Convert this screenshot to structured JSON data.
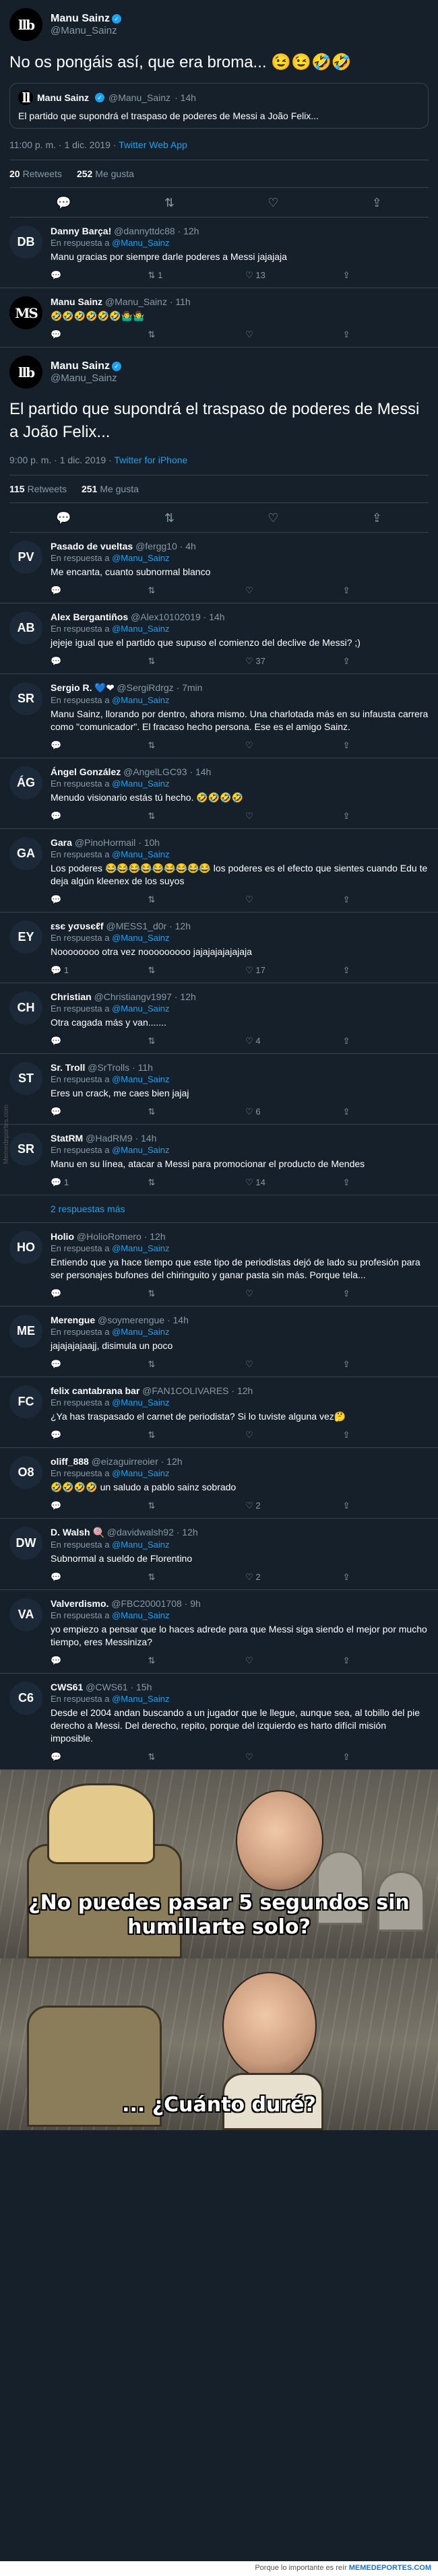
{
  "main_tweet": {
    "author": "Manu Sainz",
    "handle": "@Manu_Sainz",
    "text": "No os pongáis así, que era broma... 😉😉🤣🤣",
    "quote": {
      "author": "Manu Sainz",
      "handle": "@Manu_Sainz",
      "time": "· 14h",
      "text": "El partido que supondrá el traspaso de poderes de Messi a João Felix..."
    },
    "meta": "11:00 p. m. · 1 dic. 2019 · ",
    "source": "Twitter Web App",
    "retweets": "20",
    "retweets_label": "Retweets",
    "likes": "252",
    "likes_label": "Me gusta"
  },
  "thread_replies": [
    {
      "initials": "DB",
      "name": "Danny Barça!",
      "handle": "@dannyttdc88 · 12h",
      "reply_to_prefix": "En respuesta a ",
      "reply_to": "@Manu_Sainz",
      "text": "Manu gracias por siempre darle poderes a Messi jajajaja",
      "replies": "",
      "retweets": "1",
      "likes": "13"
    },
    {
      "initials": "MS",
      "name": "Manu Sainz",
      "handle": "@Manu_Sainz · 11h",
      "text": "🤣🤣🤣🤣🤣🤣🤷‍♂️🤷‍♂️",
      "replies": "",
      "retweets": "",
      "likes": ""
    }
  ],
  "thread_tweet": {
    "author": "Manu Sainz",
    "handle": "@Manu_Sainz",
    "text": "El partido que supondrá el traspaso de poderes de Messi a João Felix...",
    "meta": "9:00 p. m. · 1 dic. 2019 · ",
    "source": "Twitter for iPhone",
    "retweets": "115",
    "retweets_label": "Retweets",
    "likes": "251",
    "likes_label": "Me gusta"
  },
  "replies": [
    {
      "initials": "PV",
      "name": "Pasado de vueltas",
      "handle": "@fergg10 · 4h",
      "text": "Me encanta, cuanto subnormal blanco",
      "replies": "",
      "retweets": "",
      "likes": ""
    },
    {
      "initials": "AB",
      "name": "Alex Bergantiños",
      "handle": "@Alex10102019 · 14h",
      "text": "jejeje igual que el partido que supuso el comienzo del declive de Messi? ;)",
      "replies": "",
      "retweets": "",
      "likes": "37"
    },
    {
      "initials": "SR",
      "name": "Sergio R. 💙❤",
      "handle": "@SergiRdrgz · 7min",
      "text": "Manu Sainz, llorando por dentro, ahora mismo. Una charlotada más en su infausta carrera como \"comunicador\". El fracaso hecho persona. Ese es el amigo Sainz.",
      "replies": "",
      "retweets": "",
      "likes": ""
    },
    {
      "initials": "ÁG",
      "name": "Ángel González",
      "handle": "@AngelLGC93 · 14h",
      "text": "Menudo visionario estás tú hecho. 🤣🤣🤣🤣",
      "replies": "",
      "retweets": "",
      "likes": ""
    },
    {
      "initials": "GA",
      "name": "Gara",
      "handle": "@PinoHormail · 10h",
      "text": "Los poderes 😂😂😂😂😂😂😂😂😂 los poderes es el efecto que sientes cuando Edu te deja algún kleenex de los suyos",
      "replies": "",
      "retweets": "",
      "likes": ""
    },
    {
      "initials": "EY",
      "name": "εѕє уσυsєℓf",
      "handle": "@MESS1_d0r · 12h",
      "text": "Noooooooo otra vez nooooooooo jajajajajajajaja",
      "replies": "1",
      "retweets": "",
      "likes": "17"
    },
    {
      "initials": "CH",
      "name": "Christian",
      "handle": "@Christiangv1997 · 12h",
      "text": "Otra cagada más y van.......",
      "replies": "",
      "retweets": "",
      "likes": "4"
    },
    {
      "initials": "ST",
      "name": "Sr. Troll",
      "handle": "@SrTrolls · 11h",
      "text": "Eres un crack, me caes bien jajaj",
      "replies": "",
      "retweets": "",
      "likes": "6"
    },
    {
      "initials": "SR",
      "name": "StatRM",
      "handle": "@HadRM9 · 14h",
      "text": "Manu en su línea, atacar a Messi para promocionar el producto de Mendes",
      "replies": "1",
      "retweets": "",
      "likes": "14"
    }
  ],
  "more_replies": "2 respuestas más",
  "replies2": [
    {
      "initials": "HO",
      "name": "Holio",
      "handle": "@HolioRomero · 12h",
      "text": "Entiendo que ya hace tiempo que este tipo de periodistas dejó de lado su profesión para ser personajes bufones del chiringuito y ganar pasta sin más. Porque tela...",
      "replies": "",
      "retweets": "",
      "likes": ""
    },
    {
      "initials": "ME",
      "name": "Merengue",
      "handle": "@soymerengue · 14h",
      "text": "jajajajajaajj, disimula un poco",
      "replies": "",
      "retweets": "",
      "likes": ""
    },
    {
      "initials": "FC",
      "name": "felix cantabrana bar",
      "handle": "@FAN1COLIVARES · 12h",
      "text": "¿Ya has traspasado el carnet de periodista? Si lo tuviste alguna vez🤔",
      "replies": "",
      "retweets": "",
      "likes": ""
    },
    {
      "initials": "O8",
      "name": "oliff_888",
      "handle": "@eizaguirreoier · 12h",
      "text": "🤣🤣🤣🤣 un saludo a pablo sainz sobrado",
      "replies": "",
      "retweets": "",
      "likes": "2"
    },
    {
      "initials": "DW",
      "name": "D. Walsh 🍭",
      "handle": "@davidwalsh92 · 12h",
      "text": "Subnormal a sueldo de Florentino",
      "replies": "",
      "retweets": "",
      "likes": "2"
    },
    {
      "initials": "VA",
      "name": "Valverdismo.",
      "handle": "@FBC20001708 · 9h",
      "text": "yo empiezo a pensar que lo haces adrede para que Messi siga siendo el mejor por mucho tiempo, eres Messiniza?",
      "replies": "",
      "retweets": "",
      "likes": ""
    },
    {
      "initials": "C6",
      "name": "CWS61",
      "handle": "@CWS61 · 15h",
      "text": "Desde el 2004 andan buscando a un jugador que le llegue, aunque sea, al tobillo del pie derecho a Messi. Del derecho, repito, porque del izquierdo es harto difícil misión imposible.",
      "replies": "",
      "retweets": "",
      "likes": ""
    }
  ],
  "reply_to_prefix": "En respuesta a ",
  "reply_to": "@Manu_Sainz",
  "meme": {
    "caption_top": "¿No puedes pasar 5 segundos sin humillarte solo?",
    "caption_bottom": "... ¿Cuánto duré?"
  },
  "footer": {
    "text": "Porque lo importante es reír",
    "brand": "MEMEDEPORTES.COM"
  },
  "side_watermark": "Memedeportes.com"
}
